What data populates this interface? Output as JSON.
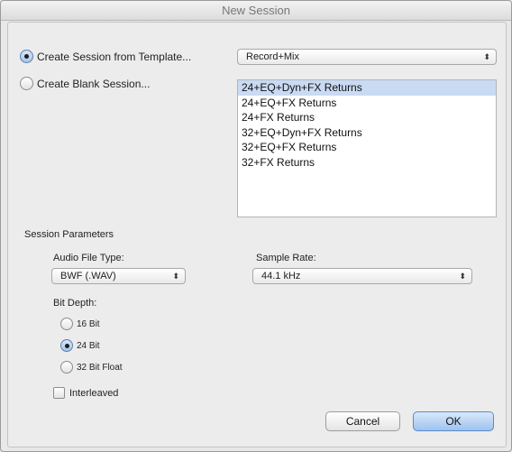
{
  "window": {
    "title": "New Session"
  },
  "session_source": {
    "from_template_label": "Create Session from Template...",
    "blank_label": "Create Blank Session...",
    "selected": "from_template"
  },
  "template_group": {
    "selected": "Record+Mix"
  },
  "templates": [
    "24+EQ+Dyn+FX Returns",
    "24+EQ+FX Returns",
    "24+FX Returns",
    "32+EQ+Dyn+FX Returns",
    "32+EQ+FX Returns",
    "32+FX Returns"
  ],
  "selected_template_index": 0,
  "params": {
    "heading": "Session Parameters",
    "audio_file_type_label": "Audio File Type:",
    "audio_file_type_value": "BWF (.WAV)",
    "sample_rate_label": "Sample Rate:",
    "sample_rate_value": "44.1 kHz",
    "bit_depth_label": "Bit Depth:",
    "bit_depth_options": [
      "16 Bit",
      "24 Bit",
      "32 Bit Float"
    ],
    "bit_depth_selected": "24 Bit",
    "interleaved_label": "Interleaved",
    "interleaved_checked": false
  },
  "buttons": {
    "cancel": "Cancel",
    "ok": "OK"
  }
}
